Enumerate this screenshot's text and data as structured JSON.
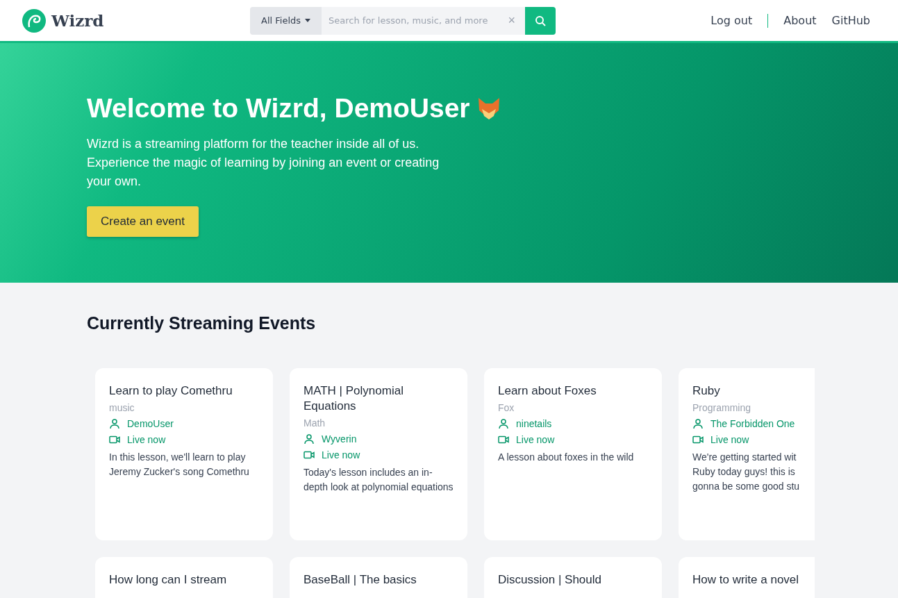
{
  "header": {
    "brand": "Wizrd",
    "search": {
      "field_filter": "All Fields",
      "placeholder": "Search for lesson, music, and more",
      "clear": "×"
    },
    "nav": [
      "Log out",
      "About",
      "GitHub"
    ]
  },
  "hero": {
    "title": "Welcome to Wizrd, DemoUser",
    "text": "Wizrd is a streaming platform for the teacher inside all of us. Experience the magic of learning by joining an event or creating your own.",
    "button": "Create an event"
  },
  "section": {
    "title": "Currently Streaming Events"
  },
  "events": [
    {
      "title": "Learn to play Comethru",
      "category": "music",
      "host": "DemoUser",
      "status": "Live now",
      "description": "In this lesson, we'll learn to play Jeremy Zucker's song Comethru"
    },
    {
      "title": "MATH | Polynomial Equations",
      "category": "Math",
      "host": "Wyverin",
      "status": "Live now",
      "description": "Today's lesson includes an in-depth look at polynomial equations"
    },
    {
      "title": "Learn about Foxes",
      "category": "Fox",
      "host": "ninetails",
      "status": "Live now",
      "description": "A lesson about foxes in the wild"
    },
    {
      "title": "Ruby",
      "category": "Programming",
      "host": "The Forbidden One",
      "status": "Live now",
      "description": "We're getting started wit\nRuby today guys! this is\ngonna be some good stu"
    },
    {
      "title": "How long can I stream"
    },
    {
      "title": "BaseBall | The basics"
    },
    {
      "title": "Discussion | Should"
    },
    {
      "title": "How to write a novel"
    }
  ]
}
